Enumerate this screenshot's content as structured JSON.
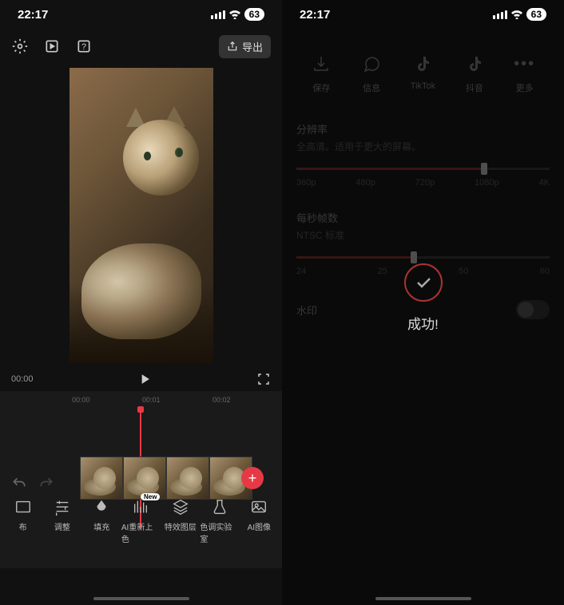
{
  "status": {
    "time": "22:17",
    "battery": "63"
  },
  "export_label": "导出",
  "preview": {
    "current": "00:00",
    "play_icon": "play"
  },
  "ruler": {
    "t0": "00:00",
    "t1": "00:01",
    "t2": "00:02"
  },
  "tools": [
    {
      "name": "canvas",
      "label": "布"
    },
    {
      "name": "adjust",
      "label": "调整"
    },
    {
      "name": "fill",
      "label": "填充"
    },
    {
      "name": "ai-recolor",
      "label": "AI重新上色",
      "badge": "New"
    },
    {
      "name": "fx-layer",
      "label": "特效图层"
    },
    {
      "name": "color-lab",
      "label": "色调实验室"
    },
    {
      "name": "ai-image",
      "label": "AI图像"
    }
  ],
  "share": [
    {
      "name": "save",
      "label": "保存"
    },
    {
      "name": "message",
      "label": "信息"
    },
    {
      "name": "tiktok",
      "label": "TikTok"
    },
    {
      "name": "douyin",
      "label": "抖音"
    },
    {
      "name": "more",
      "label": "更多"
    }
  ],
  "resolution": {
    "title": "分辨率",
    "desc": "全高清。适用于更大的屏幕。",
    "options": [
      "360p",
      "480p",
      "720p",
      "1080p",
      "4K"
    ],
    "selected": "1080p"
  },
  "fps": {
    "title": "每秒帧数",
    "desc": "NTSC 标准",
    "options": [
      "24",
      "25",
      "50",
      "60"
    ],
    "selected_index": 1
  },
  "watermark": {
    "label": "水印",
    "on": false
  },
  "success": "成功!"
}
